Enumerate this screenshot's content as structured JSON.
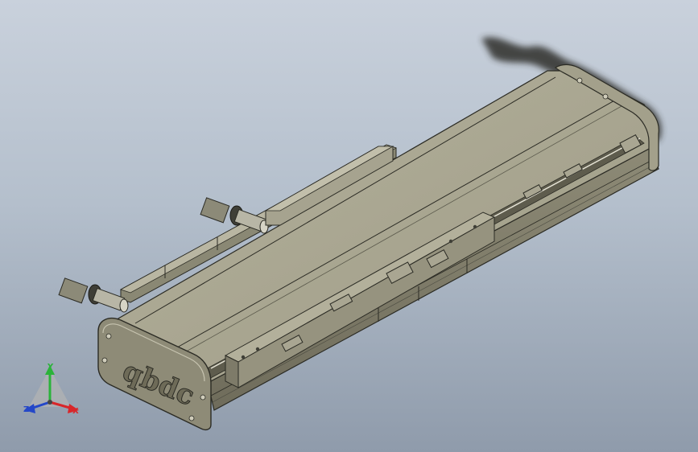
{
  "viewport": {
    "background_top": "#c9d1dc",
    "background_bottom": "#8f9bab"
  },
  "model": {
    "logo_text": "qbdc",
    "body_color": "#a8a590",
    "edge_color": "#2b2b24",
    "dark_color": "#3f3f37"
  },
  "triad": {
    "y_label": "Y",
    "x_label": "X",
    "z_label": "Z",
    "x_color": "#d8262a",
    "y_color": "#2bb33a",
    "z_color": "#2447c8"
  }
}
